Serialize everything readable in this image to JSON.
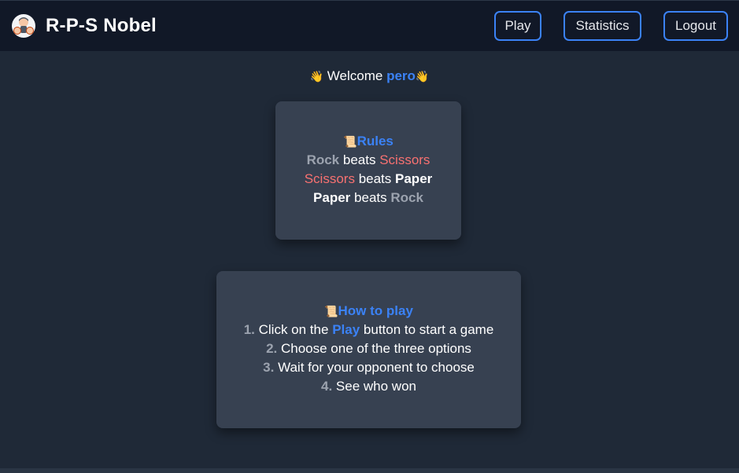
{
  "navbar": {
    "brand": "R-P-S Nobel",
    "play_label": "Play",
    "statistics_label": "Statistics",
    "logout_label": "Logout"
  },
  "welcome": {
    "wave": "👋",
    "prefix": "Welcome",
    "username": "pero"
  },
  "rules": {
    "icon": "📜",
    "title": "Rules",
    "rock": "Rock",
    "scissors": "Scissors",
    "paper": "Paper",
    "beats": "beats"
  },
  "how_to_play": {
    "icon": "📜",
    "title": "How to play",
    "step1_num": "1.",
    "step1_pre": "Click on the",
    "step1_link": "Play",
    "step1_post": "button to start a game",
    "step2_num": "2.",
    "step2": "Choose one of the three options",
    "step3_num": "3.",
    "step3": "Wait for your opponent to choose",
    "step4_num": "4.",
    "step4": "See who won"
  },
  "colors": {
    "background": "#1f2937",
    "navbar": "#111827",
    "card": "#374151",
    "accent": "#3b82f6",
    "scissors": "#f87171",
    "rock": "#9ca3af"
  }
}
